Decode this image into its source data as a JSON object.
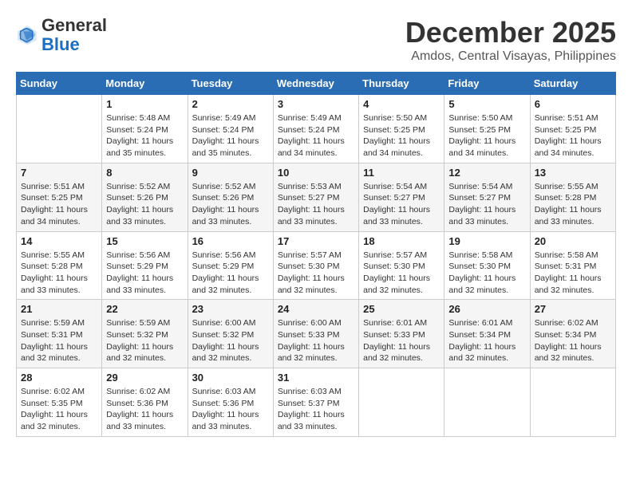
{
  "header": {
    "logo_general": "General",
    "logo_blue": "Blue",
    "month_title": "December 2025",
    "location": "Amdos, Central Visayas, Philippines"
  },
  "weekdays": [
    "Sunday",
    "Monday",
    "Tuesday",
    "Wednesday",
    "Thursday",
    "Friday",
    "Saturday"
  ],
  "weeks": [
    [
      {
        "day": "",
        "sunrise": "",
        "sunset": "",
        "daylight": ""
      },
      {
        "day": "1",
        "sunrise": "Sunrise: 5:48 AM",
        "sunset": "Sunset: 5:24 PM",
        "daylight": "Daylight: 11 hours and 35 minutes."
      },
      {
        "day": "2",
        "sunrise": "Sunrise: 5:49 AM",
        "sunset": "Sunset: 5:24 PM",
        "daylight": "Daylight: 11 hours and 35 minutes."
      },
      {
        "day": "3",
        "sunrise": "Sunrise: 5:49 AM",
        "sunset": "Sunset: 5:24 PM",
        "daylight": "Daylight: 11 hours and 34 minutes."
      },
      {
        "day": "4",
        "sunrise": "Sunrise: 5:50 AM",
        "sunset": "Sunset: 5:25 PM",
        "daylight": "Daylight: 11 hours and 34 minutes."
      },
      {
        "day": "5",
        "sunrise": "Sunrise: 5:50 AM",
        "sunset": "Sunset: 5:25 PM",
        "daylight": "Daylight: 11 hours and 34 minutes."
      },
      {
        "day": "6",
        "sunrise": "Sunrise: 5:51 AM",
        "sunset": "Sunset: 5:25 PM",
        "daylight": "Daylight: 11 hours and 34 minutes."
      }
    ],
    [
      {
        "day": "7",
        "sunrise": "Sunrise: 5:51 AM",
        "sunset": "Sunset: 5:25 PM",
        "daylight": "Daylight: 11 hours and 34 minutes."
      },
      {
        "day": "8",
        "sunrise": "Sunrise: 5:52 AM",
        "sunset": "Sunset: 5:26 PM",
        "daylight": "Daylight: 11 hours and 33 minutes."
      },
      {
        "day": "9",
        "sunrise": "Sunrise: 5:52 AM",
        "sunset": "Sunset: 5:26 PM",
        "daylight": "Daylight: 11 hours and 33 minutes."
      },
      {
        "day": "10",
        "sunrise": "Sunrise: 5:53 AM",
        "sunset": "Sunset: 5:27 PM",
        "daylight": "Daylight: 11 hours and 33 minutes."
      },
      {
        "day": "11",
        "sunrise": "Sunrise: 5:54 AM",
        "sunset": "Sunset: 5:27 PM",
        "daylight": "Daylight: 11 hours and 33 minutes."
      },
      {
        "day": "12",
        "sunrise": "Sunrise: 5:54 AM",
        "sunset": "Sunset: 5:27 PM",
        "daylight": "Daylight: 11 hours and 33 minutes."
      },
      {
        "day": "13",
        "sunrise": "Sunrise: 5:55 AM",
        "sunset": "Sunset: 5:28 PM",
        "daylight": "Daylight: 11 hours and 33 minutes."
      }
    ],
    [
      {
        "day": "14",
        "sunrise": "Sunrise: 5:55 AM",
        "sunset": "Sunset: 5:28 PM",
        "daylight": "Daylight: 11 hours and 33 minutes."
      },
      {
        "day": "15",
        "sunrise": "Sunrise: 5:56 AM",
        "sunset": "Sunset: 5:29 PM",
        "daylight": "Daylight: 11 hours and 33 minutes."
      },
      {
        "day": "16",
        "sunrise": "Sunrise: 5:56 AM",
        "sunset": "Sunset: 5:29 PM",
        "daylight": "Daylight: 11 hours and 32 minutes."
      },
      {
        "day": "17",
        "sunrise": "Sunrise: 5:57 AM",
        "sunset": "Sunset: 5:30 PM",
        "daylight": "Daylight: 11 hours and 32 minutes."
      },
      {
        "day": "18",
        "sunrise": "Sunrise: 5:57 AM",
        "sunset": "Sunset: 5:30 PM",
        "daylight": "Daylight: 11 hours and 32 minutes."
      },
      {
        "day": "19",
        "sunrise": "Sunrise: 5:58 AM",
        "sunset": "Sunset: 5:30 PM",
        "daylight": "Daylight: 11 hours and 32 minutes."
      },
      {
        "day": "20",
        "sunrise": "Sunrise: 5:58 AM",
        "sunset": "Sunset: 5:31 PM",
        "daylight": "Daylight: 11 hours and 32 minutes."
      }
    ],
    [
      {
        "day": "21",
        "sunrise": "Sunrise: 5:59 AM",
        "sunset": "Sunset: 5:31 PM",
        "daylight": "Daylight: 11 hours and 32 minutes."
      },
      {
        "day": "22",
        "sunrise": "Sunrise: 5:59 AM",
        "sunset": "Sunset: 5:32 PM",
        "daylight": "Daylight: 11 hours and 32 minutes."
      },
      {
        "day": "23",
        "sunrise": "Sunrise: 6:00 AM",
        "sunset": "Sunset: 5:32 PM",
        "daylight": "Daylight: 11 hours and 32 minutes."
      },
      {
        "day": "24",
        "sunrise": "Sunrise: 6:00 AM",
        "sunset": "Sunset: 5:33 PM",
        "daylight": "Daylight: 11 hours and 32 minutes."
      },
      {
        "day": "25",
        "sunrise": "Sunrise: 6:01 AM",
        "sunset": "Sunset: 5:33 PM",
        "daylight": "Daylight: 11 hours and 32 minutes."
      },
      {
        "day": "26",
        "sunrise": "Sunrise: 6:01 AM",
        "sunset": "Sunset: 5:34 PM",
        "daylight": "Daylight: 11 hours and 32 minutes."
      },
      {
        "day": "27",
        "sunrise": "Sunrise: 6:02 AM",
        "sunset": "Sunset: 5:34 PM",
        "daylight": "Daylight: 11 hours and 32 minutes."
      }
    ],
    [
      {
        "day": "28",
        "sunrise": "Sunrise: 6:02 AM",
        "sunset": "Sunset: 5:35 PM",
        "daylight": "Daylight: 11 hours and 32 minutes."
      },
      {
        "day": "29",
        "sunrise": "Sunrise: 6:02 AM",
        "sunset": "Sunset: 5:36 PM",
        "daylight": "Daylight: 11 hours and 33 minutes."
      },
      {
        "day": "30",
        "sunrise": "Sunrise: 6:03 AM",
        "sunset": "Sunset: 5:36 PM",
        "daylight": "Daylight: 11 hours and 33 minutes."
      },
      {
        "day": "31",
        "sunrise": "Sunrise: 6:03 AM",
        "sunset": "Sunset: 5:37 PM",
        "daylight": "Daylight: 11 hours and 33 minutes."
      },
      {
        "day": "",
        "sunrise": "",
        "sunset": "",
        "daylight": ""
      },
      {
        "day": "",
        "sunrise": "",
        "sunset": "",
        "daylight": ""
      },
      {
        "day": "",
        "sunrise": "",
        "sunset": "",
        "daylight": ""
      }
    ]
  ]
}
